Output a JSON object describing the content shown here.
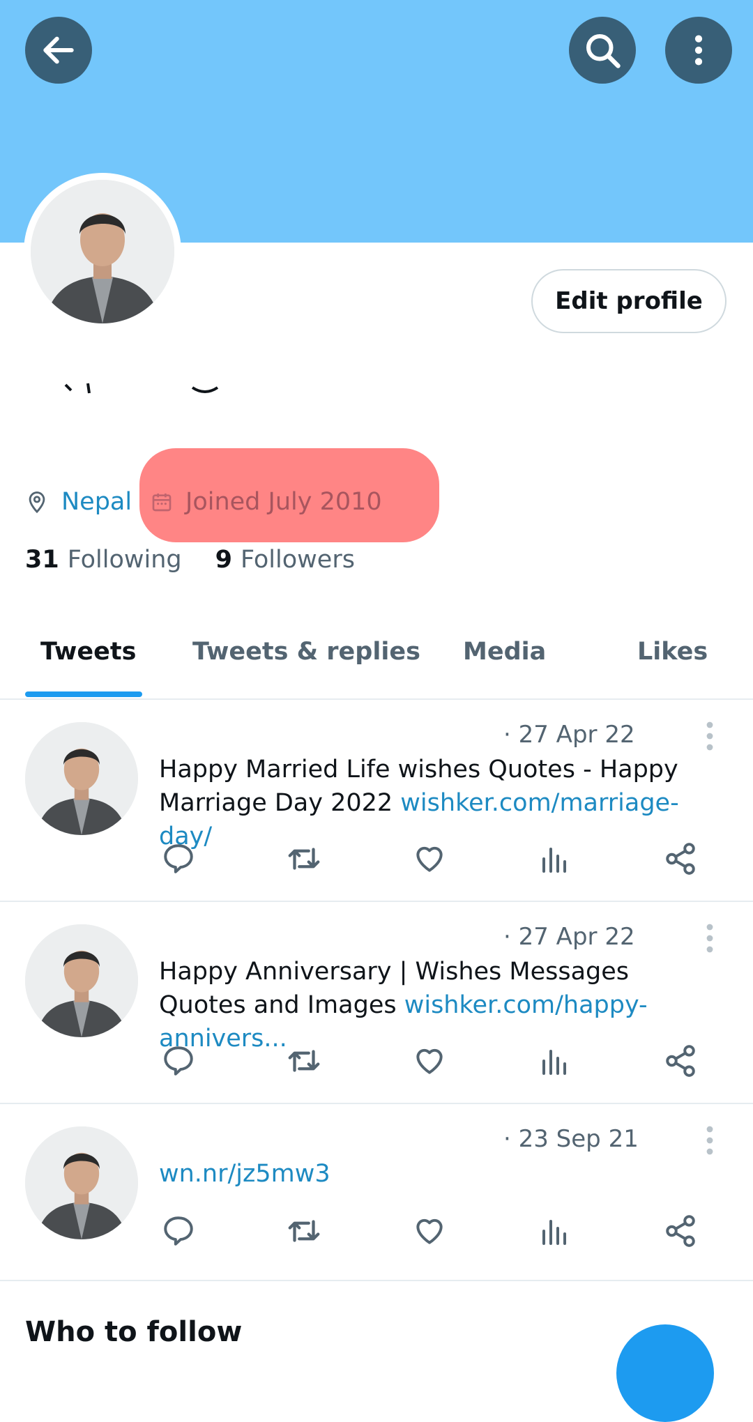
{
  "header": {
    "back_icon": "arrow-left-icon",
    "search_icon": "search-icon",
    "more_icon": "more-vertical-icon",
    "banner_color": "#73c6fb"
  },
  "profile": {
    "edit_label": "Edit profile",
    "location": "Nepal",
    "joined": "Joined July 2010",
    "following_count": "31",
    "following_label": "Following",
    "followers_count": "9",
    "followers_label": "Followers"
  },
  "tabs": [
    {
      "label": "Tweets",
      "active": true
    },
    {
      "label": "Tweets & replies",
      "active": false
    },
    {
      "label": "Media",
      "active": false
    },
    {
      "label": "Likes",
      "active": false
    }
  ],
  "tweets": [
    {
      "date": "· 27 Apr 22",
      "text": "Happy Married Life wishes Quotes - Happy Marriage Day 2022 ",
      "link": "wishker.com/marriage-day/"
    },
    {
      "date": "· 27 Apr 22",
      "text": "Happy Anniversary | Wishes Messages Quotes and Images ",
      "link": "wishker.com/happy-annivers..."
    },
    {
      "date": "· 23 Sep 21",
      "text": "",
      "link": "wn.nr/jz5mw3"
    }
  ],
  "who_to_follow": "Who to follow",
  "colors": {
    "accent": "#1d9bf0",
    "link": "#1d8ac2",
    "highlight": "#ff8585",
    "muted": "#536471"
  }
}
